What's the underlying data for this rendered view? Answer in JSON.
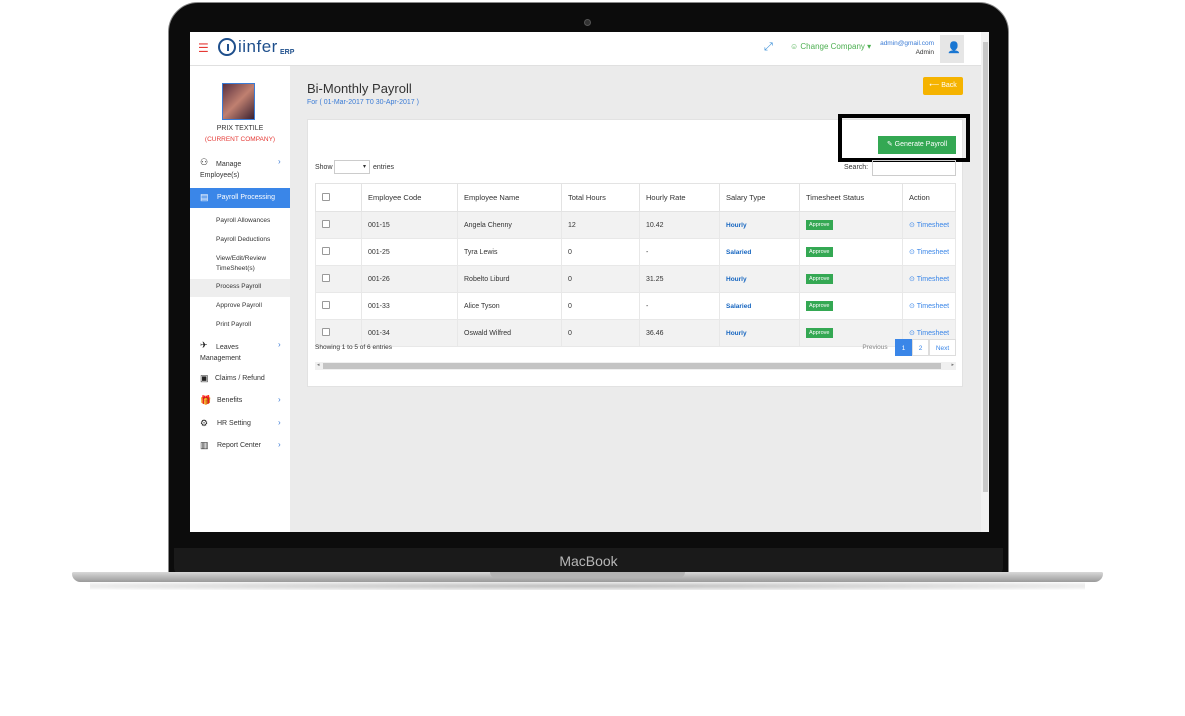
{
  "device": {
    "brand": "MacBook"
  },
  "header": {
    "logo_text": "iinfer",
    "logo_suffix": "ERP",
    "change_company": "Change Company",
    "user_email": "admin@gmail.com",
    "user_role": "Admin"
  },
  "sidebar": {
    "company_name": "PRIX TEXTILE",
    "company_status": "(CURRENT COMPANY)",
    "items": [
      {
        "label": "Manage Employee(s)",
        "icon": "user-icon"
      },
      {
        "label": "Payroll Processing",
        "icon": "payroll-icon"
      },
      {
        "label": "Leaves Management",
        "icon": "plane-icon"
      },
      {
        "label": "Claims / Refund",
        "icon": "money-icon"
      },
      {
        "label": "Benefits",
        "icon": "gift-icon"
      },
      {
        "label": "HR Setting",
        "icon": "gear-icon"
      },
      {
        "label": "Report Center",
        "icon": "bar-chart-icon"
      }
    ],
    "subitems": [
      "Payroll Allowances",
      "Payroll Deductions",
      "View/Edit/Review TimeSheet(s)",
      "Process Payroll",
      "Approve Payroll",
      "Print Payroll"
    ]
  },
  "page": {
    "title": "Bi-Monthly Payroll",
    "subtitle": "For ( 01-Mar-2017 T0 30-Apr-2017 )",
    "back_label": "Back",
    "generate_label": "Generate Payroll"
  },
  "table": {
    "show_label": "Show",
    "entries_label": "entries",
    "search_label": "Search:",
    "columns": [
      "Employee Code",
      "Employee Name",
      "Total Hours",
      "Hourly Rate",
      "Salary Type",
      "Timesheet Status",
      "Action"
    ],
    "rows": [
      {
        "code": "001-15",
        "name": "Angela Chenny",
        "hours": "12",
        "rate": "10.42",
        "type": "Hourly",
        "status": "Approve",
        "action": "Timesheet"
      },
      {
        "code": "001-25",
        "name": "Tyra Lewis",
        "hours": "0",
        "rate": "-",
        "type": "Salaried",
        "status": "Approve",
        "action": "Timesheet"
      },
      {
        "code": "001-26",
        "name": "Robelto Liburd",
        "hours": "0",
        "rate": "31.25",
        "type": "Hourly",
        "status": "Approve",
        "action": "Timesheet"
      },
      {
        "code": "001-33",
        "name": "Alice Tyson",
        "hours": "0",
        "rate": "-",
        "type": "Salaried",
        "status": "Approve",
        "action": "Timesheet"
      },
      {
        "code": "001-34",
        "name": "Oswald Wilfred",
        "hours": "0",
        "rate": "36.46",
        "type": "Hourly",
        "status": "Approve",
        "action": "Timesheet"
      }
    ],
    "showing_text": "Showing 1 to 5 of 6 entries",
    "pager": {
      "previous": "Previous",
      "pages": [
        "1",
        "2"
      ],
      "next": "Next"
    }
  },
  "colors": {
    "accent": "#3a86e8",
    "success": "#34a853",
    "warning": "#f5b300",
    "danger": "#e53935"
  }
}
